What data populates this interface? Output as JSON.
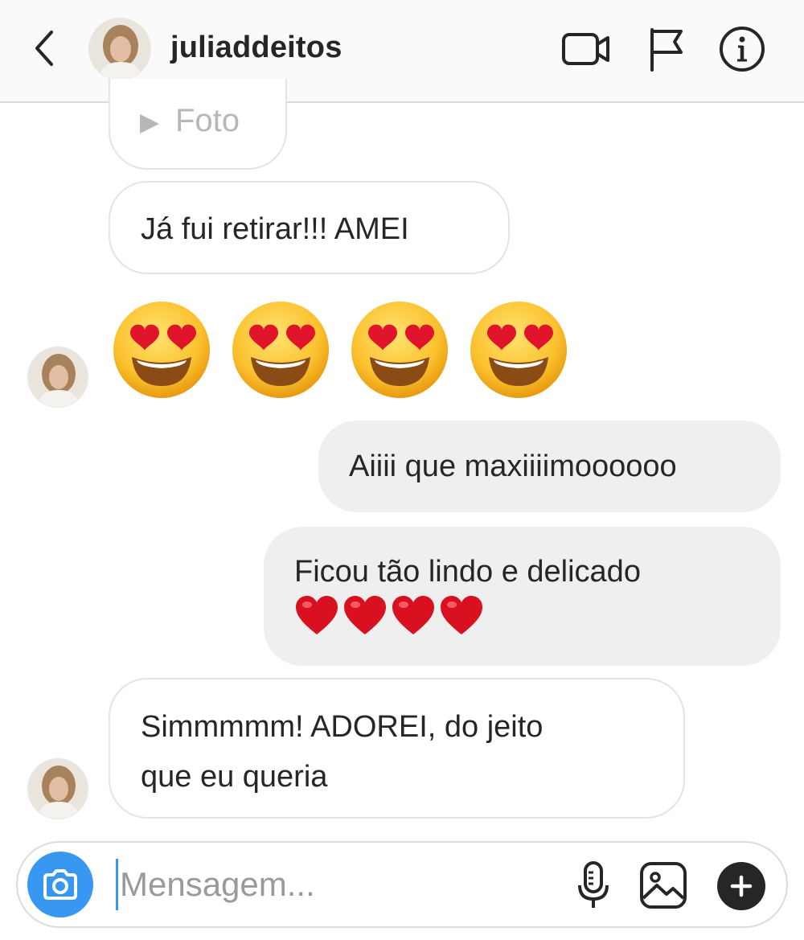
{
  "header": {
    "username": "juliaddeitos",
    "icons": [
      "back-chevron-icon",
      "avatar",
      "video-call-icon",
      "flag-icon",
      "info-icon"
    ]
  },
  "messages": [
    {
      "id": "foto",
      "direction": "incoming",
      "type": "media-label",
      "text": "Foto"
    },
    {
      "id": "m1",
      "direction": "incoming",
      "type": "text",
      "text": "Já fui retirar!!! AMEI"
    },
    {
      "id": "m2",
      "direction": "incoming",
      "type": "emoji",
      "emojis": [
        "heart-eyes",
        "heart-eyes",
        "heart-eyes",
        "heart-eyes"
      ]
    },
    {
      "id": "m3",
      "direction": "outgoing",
      "type": "text",
      "text": "Aiiii que maxiiiimoooooo"
    },
    {
      "id": "m4",
      "direction": "outgoing",
      "type": "text",
      "text": "Ficou tão lindo e delicado",
      "hearts": 4
    },
    {
      "id": "m5",
      "direction": "incoming",
      "type": "text",
      "line1": "Simmmmm! ADOREI, do jeito",
      "line2": "que eu queria"
    }
  ],
  "composer": {
    "placeholder": "Mensagem...",
    "icons": [
      "camera-icon",
      "microphone-icon",
      "gallery-icon",
      "plus-icon"
    ]
  },
  "colors": {
    "accent": "#3897f0",
    "outgoing_bubble": "#efefef",
    "incoming_border": "#e4e4e4",
    "text": "#262626",
    "heart": "#e0142a",
    "emoji_face": "#fbc02d"
  }
}
